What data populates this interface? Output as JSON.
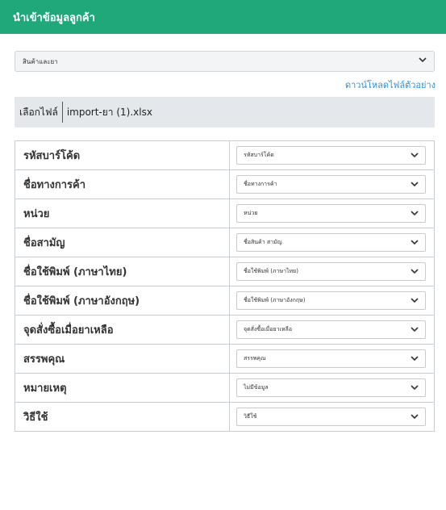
{
  "header": {
    "title": "นำเข้าข้อมูลลูกค้า"
  },
  "category_select": {
    "value": "สินค้าและยา"
  },
  "download_link": "ดาวน์โหลดไฟล์ตัวอย่าง",
  "file": {
    "choose_label": "เลือกไฟล์",
    "filename": "import-ยา (1).xlsx"
  },
  "mapping": [
    {
      "field": "รหัสบาร์โค้ด",
      "selected": "รหัสบาร์โค้ด"
    },
    {
      "field": "ชื่อทางการค้า",
      "selected": "ชื่อทางการค้า"
    },
    {
      "field": "หน่วย",
      "selected": "หน่วย"
    },
    {
      "field": "ชื่อสามัญ",
      "selected": "ชื่อสินค้า สามัญ"
    },
    {
      "field": "ชื่อใช้พิมพ์ (ภาษาไทย)",
      "selected": "ชื่อใช้พิมพ์ (ภาษาไทย)"
    },
    {
      "field": "ชื่อใช้พิมพ์ (ภาษาอังกฤษ)",
      "selected": "ชื่อใช้พิมพ์ (ภาษาอังกฤษ)"
    },
    {
      "field": "จุดสั่งซื้อเมื่อยาเหลือ",
      "selected": "จุดสั่งซื้อเมื่อยาเหลือ"
    },
    {
      "field": "สรรพคุณ",
      "selected": "สรรพคุณ"
    },
    {
      "field": "หมายเหตุ",
      "selected": "ไม่มีข้อมูล"
    },
    {
      "field": "วิธีใช้",
      "selected": "วิธีใช้"
    }
  ],
  "icons": {
    "dropdown": "chevron-down-icon"
  },
  "colors": {
    "header_bg": "#20a77a",
    "link": "#2a8fe0",
    "file_row_bg": "#e4e8ec"
  }
}
